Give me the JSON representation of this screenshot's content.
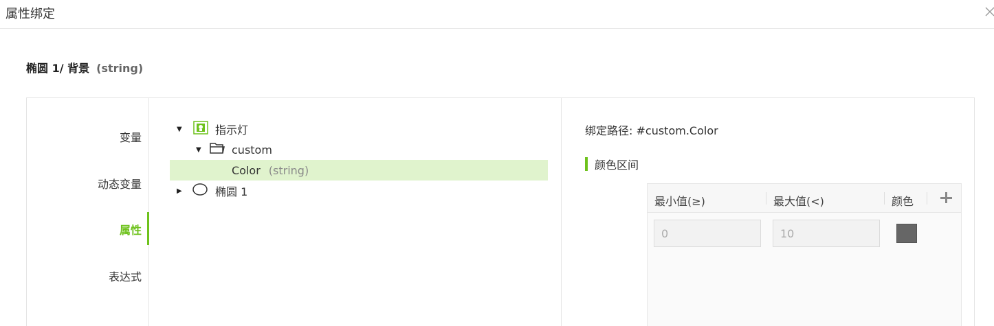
{
  "dialog": {
    "title": "属性绑定",
    "subtitle_main": "椭圆 1/ 背景",
    "subtitle_type": "(string)"
  },
  "sidebar": {
    "items": [
      {
        "label": "变量",
        "active": false
      },
      {
        "label": "动态变量",
        "active": false
      },
      {
        "label": "属性",
        "active": true
      },
      {
        "label": "表达式",
        "active": false
      }
    ]
  },
  "tree": {
    "nodes": [
      {
        "label": "指示灯",
        "icon": "indicator-light-icon",
        "expanded": true
      },
      {
        "label": "custom",
        "icon": "folder-open-icon",
        "expanded": true
      },
      {
        "label": "Color",
        "type": "(string)",
        "selected": true
      },
      {
        "label": "椭圆 1",
        "icon": "ellipse-icon",
        "expanded": false
      }
    ]
  },
  "binding": {
    "path_label": "绑定路径:",
    "path_value": "#custom.Color",
    "section_title": "颜色区间"
  },
  "color_table": {
    "headers": {
      "min": "最小值(≥)",
      "max": "最大值(<)",
      "color": "颜色"
    },
    "rows": [
      {
        "min": "0",
        "max": "10",
        "color": "#666666"
      }
    ]
  },
  "colors": {
    "accent": "#6ec21c",
    "selected_bg": "#e0f3cd"
  }
}
